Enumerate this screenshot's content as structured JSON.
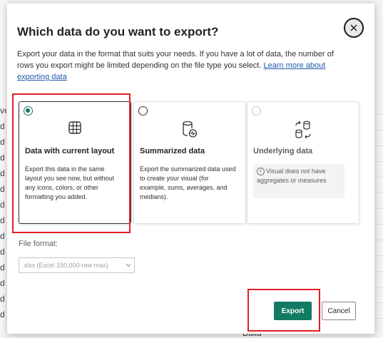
{
  "background": {
    "left_edge_chars": [
      "ve",
      "d",
      "d",
      "d",
      "d",
      "d",
      "d",
      "d",
      "d",
      "d",
      "d",
      "d",
      "d",
      "d"
    ],
    "bottom_text": "Build"
  },
  "dialog": {
    "title": "Which data do you want to export?",
    "description": "Export your data in the format that suits your needs. If you have a lot of data, the number of rows you export might be limited depending on the file type you select.",
    "learn_more_link": "Learn more about exporting data",
    "options": [
      {
        "title": "Data with current layout",
        "text": "Export this data in the same layout you see now, but without any icons, colors, or other formatting you added.",
        "selected": true,
        "icon": "table-grid-icon"
      },
      {
        "title": "Summarized data",
        "text": "Export the summarized data used to create your visual (for example, sums, averages, and medians).",
        "selected": false,
        "icon": "database-pulse-icon"
      },
      {
        "title": "Underlying data",
        "info": "Visual does not have aggregates or measures",
        "selected": false,
        "disabled": true,
        "icon": "data-transform-icon"
      }
    ],
    "file_format": {
      "label": "File format:",
      "value": ".xlsx (Excel 150,000-row max)"
    },
    "buttons": {
      "export": "Export",
      "cancel": "Cancel"
    },
    "colors": {
      "accent": "#117865",
      "highlight": "#e31e24"
    }
  }
}
